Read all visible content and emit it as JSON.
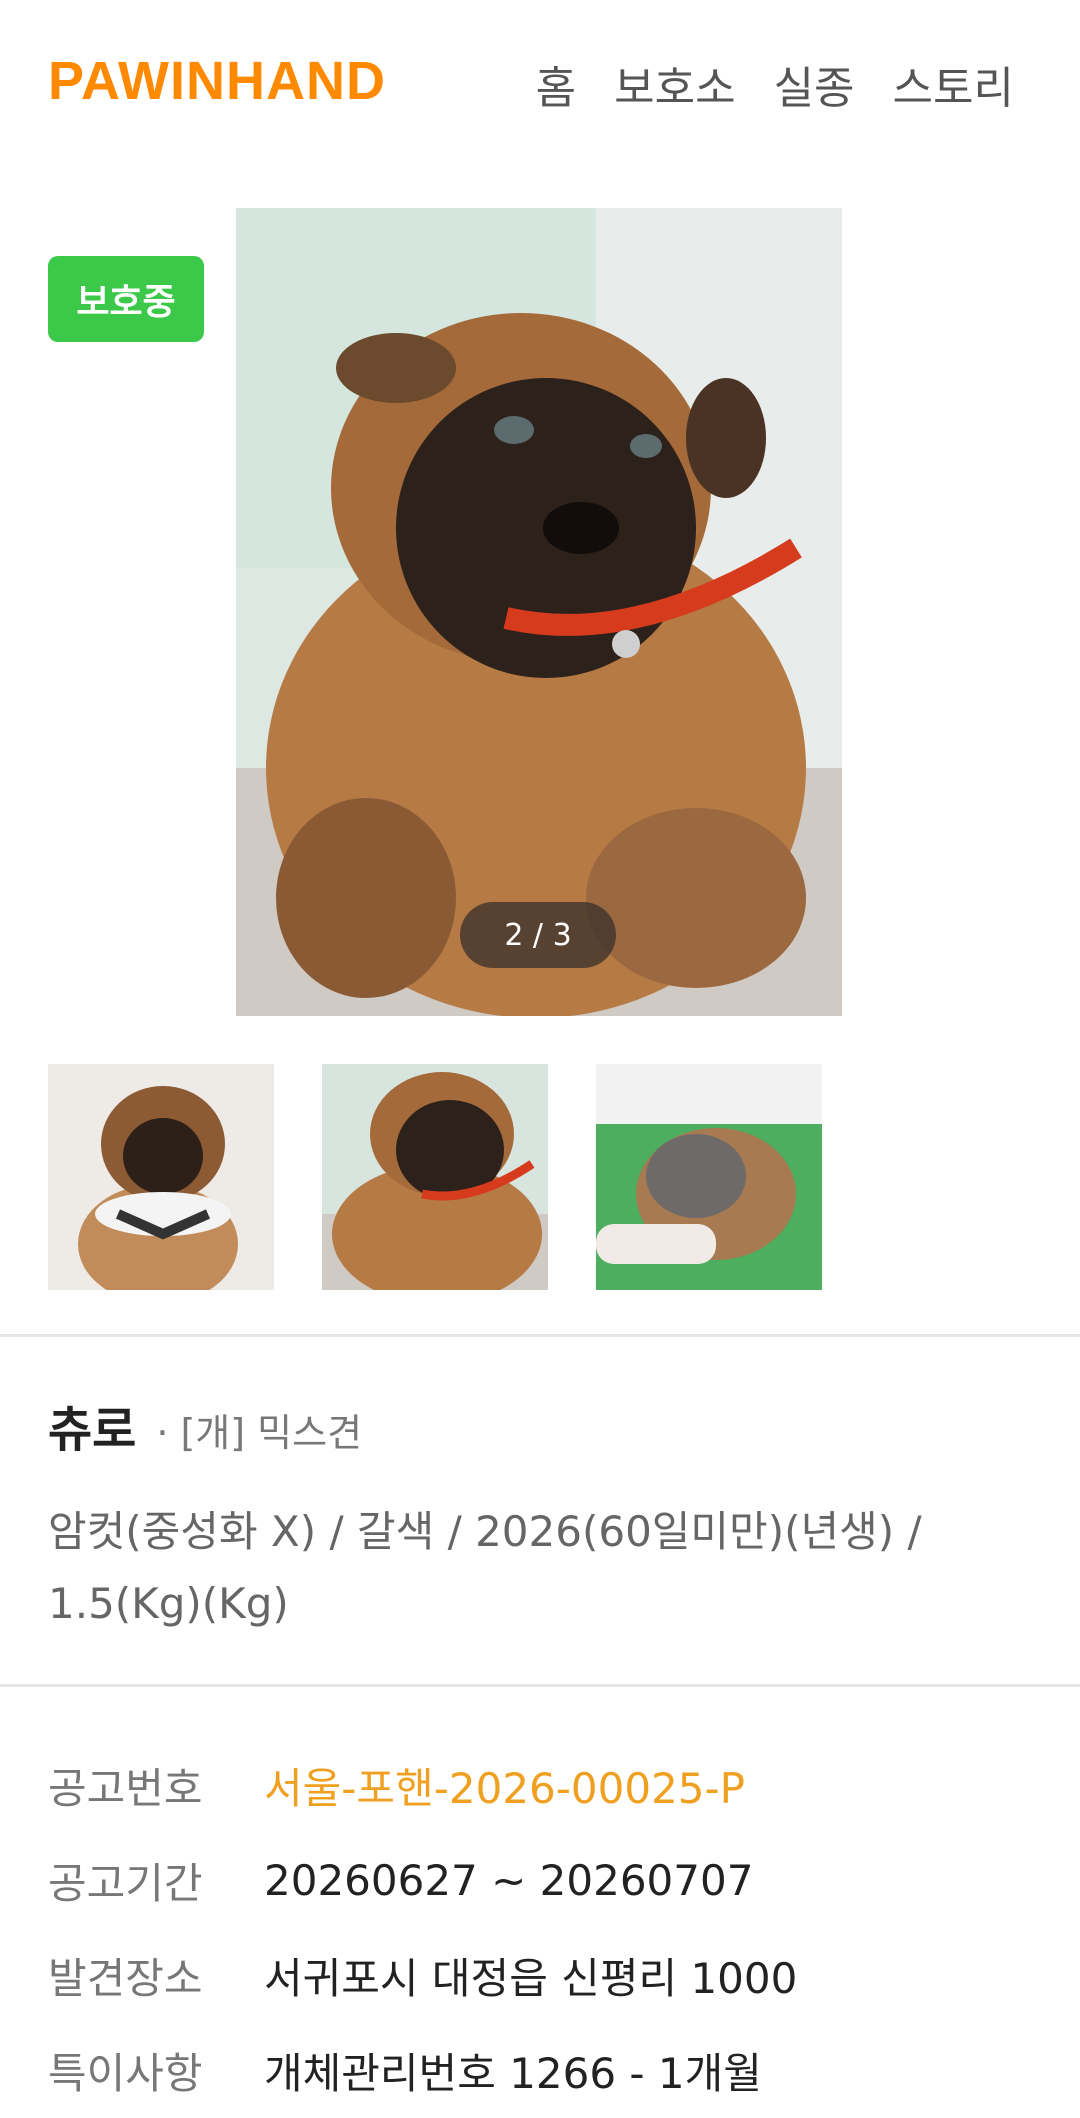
{
  "header": {
    "logo": "PAWINHAND",
    "nav": [
      "홈",
      "보호소",
      "실종",
      "스토리"
    ]
  },
  "photo": {
    "status_badge": "보호중",
    "counter": "2 / 3"
  },
  "animal": {
    "name": "츄로",
    "breed": "· [개] 믹스견",
    "attributes": "암컷(중성화 X) / 갈색 / 2026(60일미만)(년생) / 1.5(Kg)(Kg)"
  },
  "details": [
    {
      "label": "공고번호",
      "value": "서울-포핸-2026-00025-P"
    },
    {
      "label": "공고기간",
      "value": "20260627 ~ 20260707"
    },
    {
      "label": "발견장소",
      "value": "서귀포시 대정읍 신평리 1000"
    },
    {
      "label": "특이사항",
      "value": "개체관리번호 1266 - 1개월"
    }
  ],
  "colors": {
    "brand": "#FF8A00",
    "status_badge": "#3CC94A",
    "notice_number": "#F0A020"
  }
}
